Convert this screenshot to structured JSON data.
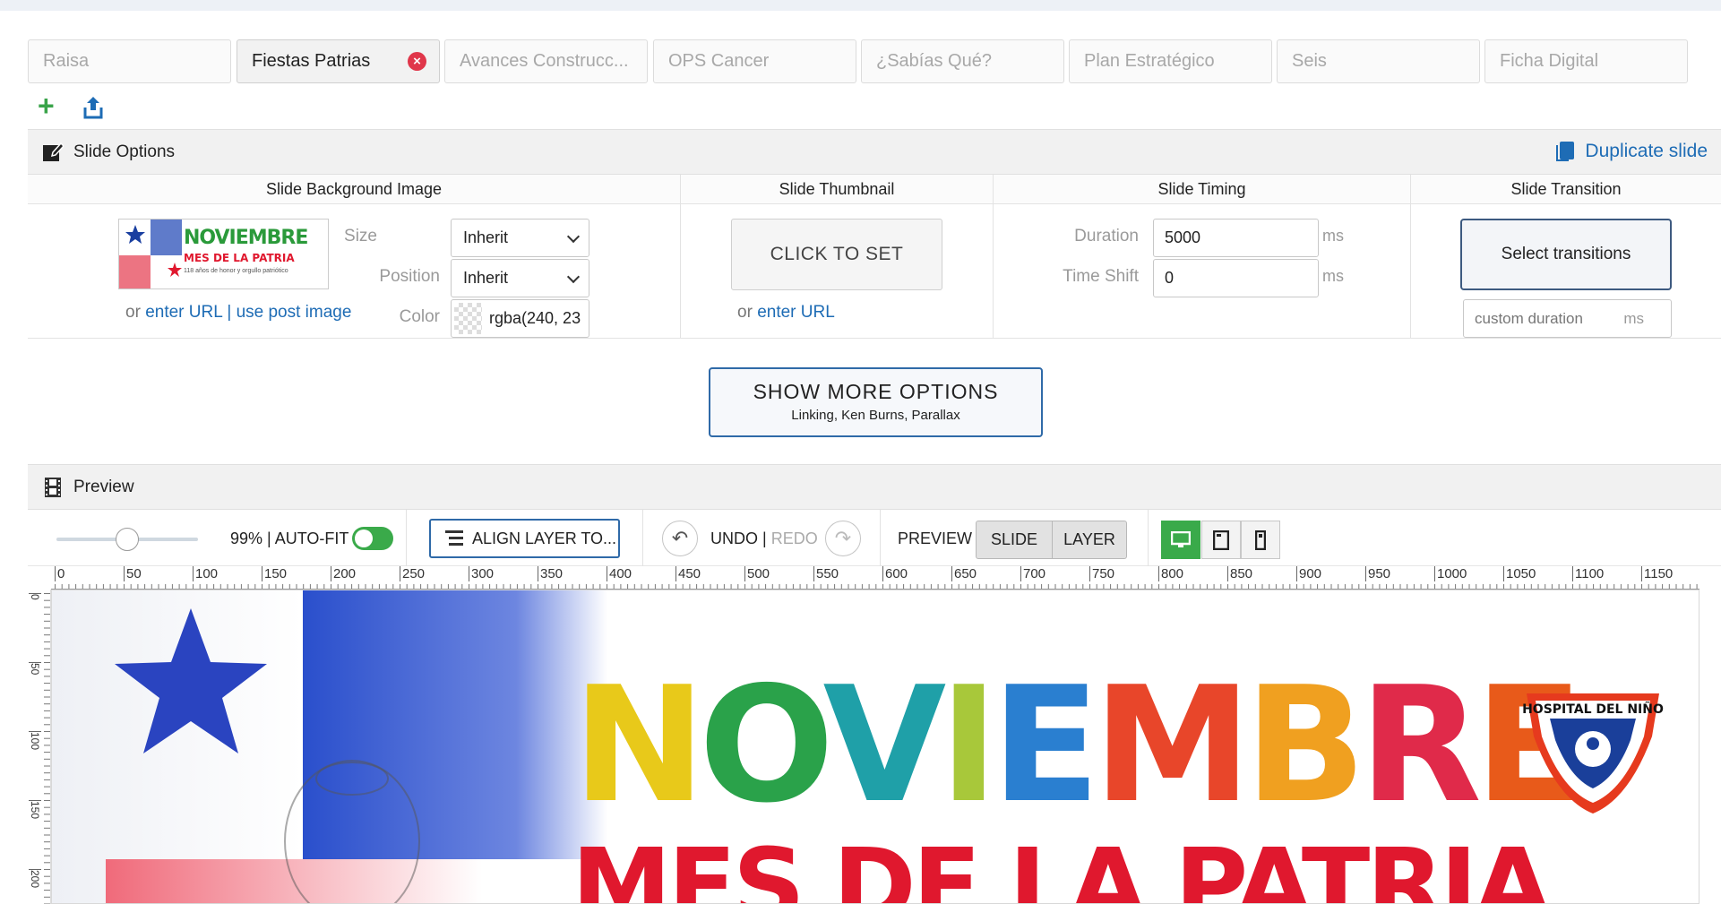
{
  "tabs": [
    {
      "label": "Raisa",
      "active": false
    },
    {
      "label": "Fiestas Patrias",
      "active": true
    },
    {
      "label": "Avances Construcc...",
      "active": false
    },
    {
      "label": "OPS Cancer",
      "active": false
    },
    {
      "label": "¿Sabías Qué?",
      "active": false
    },
    {
      "label": "Plan Estratégico",
      "active": false
    },
    {
      "label": "Seis",
      "active": false
    },
    {
      "label": "Ficha Digital",
      "active": false
    }
  ],
  "slide_options": {
    "title": "Slide Options",
    "duplicate_label": "Duplicate slide"
  },
  "columns": {
    "background": "Slide Background Image",
    "thumbnail": "Slide Thumbnail",
    "timing": "Slide Timing",
    "transition": "Slide Transition"
  },
  "background": {
    "size_label": "Size",
    "size_value": "Inherit",
    "position_label": "Position",
    "position_value": "Inherit",
    "color_label": "Color",
    "color_value": "rgba(240, 23",
    "links": {
      "or": "or",
      "enter_url": "enter URL",
      "sep": "|",
      "use_post": "use post image"
    },
    "thumb_text": {
      "line1": "NOVIEMBRE",
      "line2": "MES DE LA PATRIA",
      "line3": "118 años de honor y orgullo patriótico"
    }
  },
  "thumbnail": {
    "button": "CLICK TO SET",
    "or": "or",
    "enter_url": "enter URL"
  },
  "timing": {
    "duration_label": "Duration",
    "duration_value": "5000",
    "shift_label": "Time Shift",
    "shift_value": "0",
    "unit": "ms"
  },
  "transition": {
    "button": "Select transitions",
    "custom_placeholder": "custom duration",
    "unit": "ms"
  },
  "more_options": {
    "title": "SHOW MORE OPTIONS",
    "subtitle": "Linking, Ken Burns, Parallax"
  },
  "preview": {
    "title": "Preview"
  },
  "toolbar": {
    "zoom_text": "99% | AUTO-FIT",
    "align": "ALIGN LAYER TO...",
    "undo": "UNDO",
    "redo_sep": "|",
    "redo": "REDO",
    "preview": "PREVIEW",
    "slide": "SLIDE",
    "layer": "LAYER"
  },
  "ruler": {
    "top": [
      "0",
      "50",
      "100",
      "150",
      "200",
      "250",
      "300",
      "350",
      "400",
      "450",
      "500",
      "550",
      "600",
      "650",
      "700",
      "750",
      "800",
      "850",
      "900",
      "950",
      "1000",
      "1050",
      "1100",
      "1150"
    ],
    "left": [
      "0",
      "50",
      "100",
      "150",
      "200"
    ]
  },
  "canvas": {
    "headline": "NOVIEMBRE",
    "subline": "MES DE LA PATRIA",
    "badge": "HOSPITAL DEL NIÑO"
  },
  "colors": {
    "accent": "#1e6cb5",
    "green": "#3aaa4a",
    "red": "#e0182e",
    "close": "#e0364a"
  }
}
